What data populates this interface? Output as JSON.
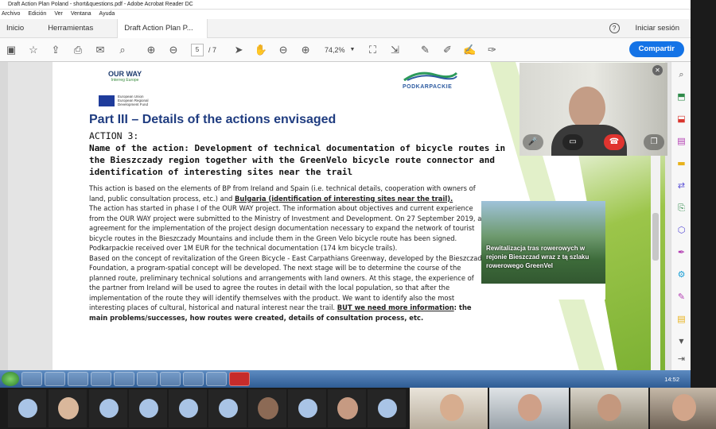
{
  "window": {
    "title": "Draft Action Plan Poland - short&questions.pdf - Adobe Acrobat Reader DC"
  },
  "menu": [
    "Archivo",
    "Edición",
    "Ver",
    "Ventana",
    "Ayuda"
  ],
  "tabs": {
    "home": "Inicio",
    "tools": "Herramientas",
    "document": "Draft Action Plan P...",
    "signin": "Iniciar sesión",
    "help": "?"
  },
  "toolbar": {
    "page_current": "5",
    "page_total": "/ 7",
    "zoom": "74,2%",
    "share_label": "Compartir"
  },
  "document": {
    "logo_ourway": "OUR WAY",
    "logo_ourway_sub": "Interreg Europe",
    "eu_text": [
      "European Union",
      "European Regional",
      "Development Fund"
    ],
    "logo_podkarpackie": "PODKARPACKIE",
    "part_title": "Part III – Details of the actions envisaged",
    "action_label": "ACTION 3:",
    "action_name": "Name of the action: Development of technical documentation of bicycle routes in the Bieszczady region together with the GreenVelo bicycle route connector and identification of interesting sites near the trail",
    "p1_start": "This action is based on the elements of BP from Ireland and Spain (i.e. technical details, cooperation with owners of land, public consultation process, etc.) and ",
    "p1_underlined": "Bulgaria (identification of interesting sites near the trail).",
    "p2": "The action has started in phase I of the OUR WAY project. The information about objectives and current experience from the OUR WAY project were submitted to the Ministry of Investment and Development. On 27 September 2019, an agreement for the implementation of the project design documentation necessary to expand the network of tourist bicycle routes in the Bieszczady Mountains and include them in the Green Velo bicycle route has been signed. Podkarpackie received over 1M EUR for the technical documentation (174 km bicycle trails).",
    "p3_start": "Based on the concept of revitalization of the Green Bicycle - East Carpathians Greenway, developed by the Bieszczady Foundation, a program-spatial concept will be developed. The next stage will be to determine the course of the planned route, preliminary technical solutions and arrangements with land owners. At this stage, the experience of the partner from Ireland will be used to agree the routes in detail with the local population, so that after the implementation of the route they will identify themselves with the product. We want to identify also the most interesting places of cultural, historical and natural interest near the trail. ",
    "p3_underlined": "BUT we need more information",
    "p3_bold": ": the main problems/successes, how routes were created, details of consultation process, etc.",
    "photo_caption": "Rewitalizacja tras rowerowych w rejonie Bieszczad wraz z tą szlaku rowerowego GreenVel"
  },
  "taskbar": {
    "clock": "14:52"
  },
  "colors": {
    "accent": "#1473e6",
    "title_blue": "#1f3c80",
    "hangup": "#e0342f"
  }
}
